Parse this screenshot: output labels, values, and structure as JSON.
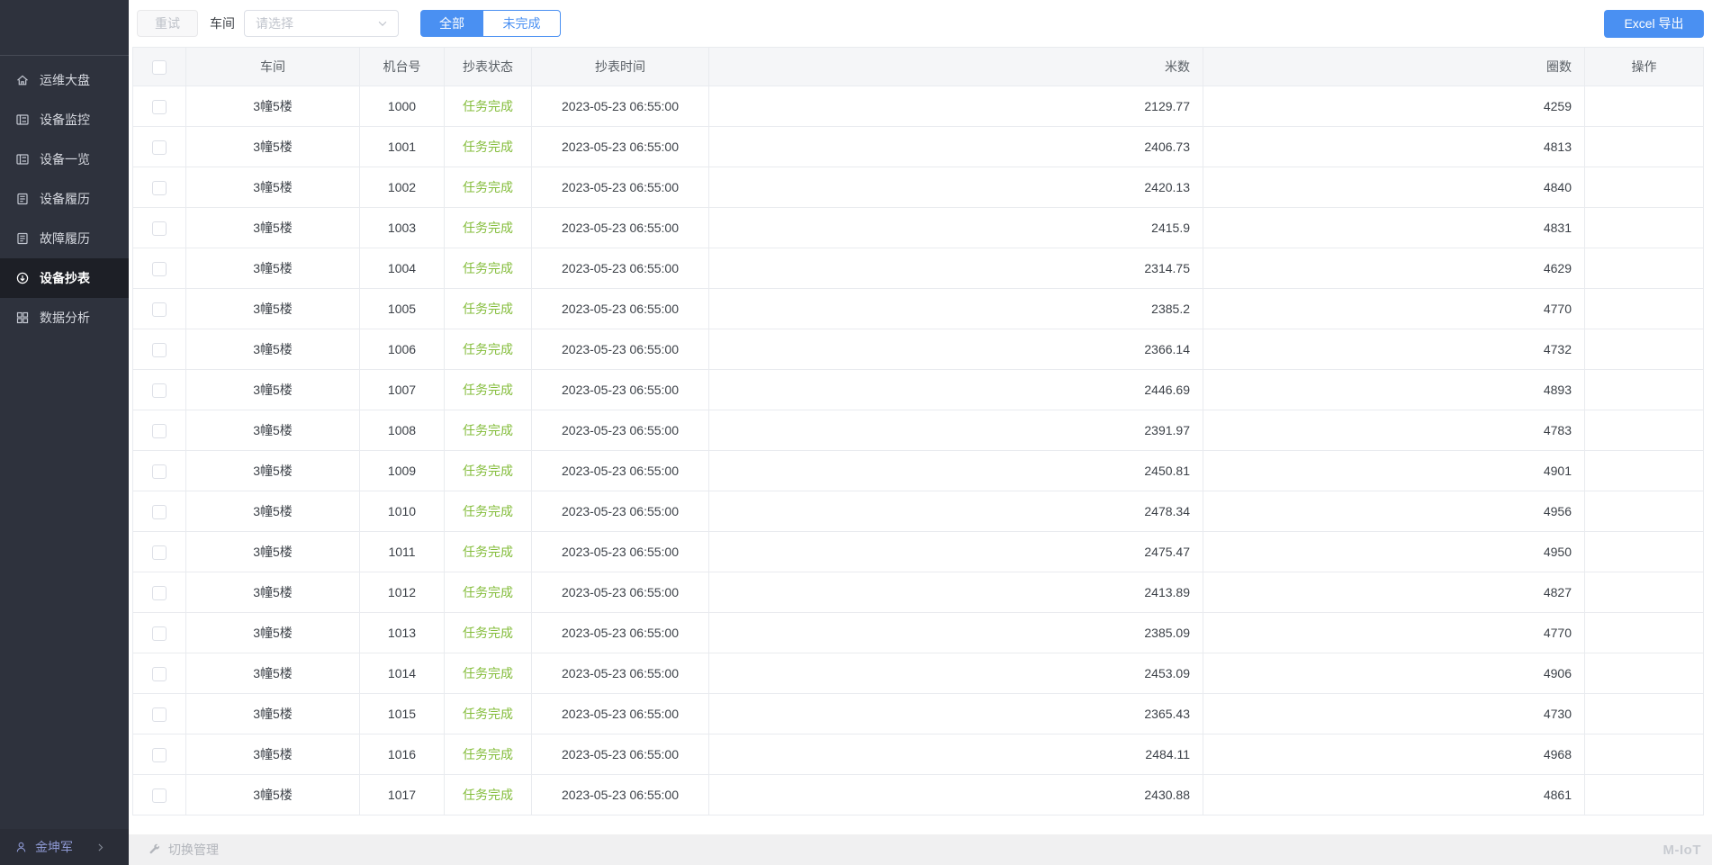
{
  "sidebar": {
    "items": [
      {
        "label": "运维大盘",
        "icon": "home-icon",
        "active": false
      },
      {
        "label": "设备监控",
        "icon": "device-monitor-icon",
        "active": false
      },
      {
        "label": "设备一览",
        "icon": "device-list-icon",
        "active": false
      },
      {
        "label": "设备履历",
        "icon": "device-history-icon",
        "active": false
      },
      {
        "label": "故障履历",
        "icon": "fault-history-icon",
        "active": false
      },
      {
        "label": "设备抄表",
        "icon": "meter-reading-icon",
        "active": true
      },
      {
        "label": "数据分析",
        "icon": "data-analysis-icon",
        "active": false
      }
    ],
    "user": {
      "name": "金坤军"
    }
  },
  "toolbar": {
    "retry_label": "重试",
    "workshop_label": "车间",
    "select_placeholder": "请选择",
    "filter_all": "全部",
    "filter_incomplete": "未完成",
    "export_label": "Excel 导出"
  },
  "table": {
    "columns": [
      "车间",
      "机台号",
      "抄表状态",
      "抄表时间",
      "米数",
      "圈数",
      "操作"
    ],
    "rows": [
      {
        "workshop": "3幢5楼",
        "machine": "1000",
        "status": "任务完成",
        "time": "2023-05-23 06:55:00",
        "meters": "2129.77",
        "loops": "4259"
      },
      {
        "workshop": "3幢5楼",
        "machine": "1001",
        "status": "任务完成",
        "time": "2023-05-23 06:55:00",
        "meters": "2406.73",
        "loops": "4813"
      },
      {
        "workshop": "3幢5楼",
        "machine": "1002",
        "status": "任务完成",
        "time": "2023-05-23 06:55:00",
        "meters": "2420.13",
        "loops": "4840"
      },
      {
        "workshop": "3幢5楼",
        "machine": "1003",
        "status": "任务完成",
        "time": "2023-05-23 06:55:00",
        "meters": "2415.9",
        "loops": "4831"
      },
      {
        "workshop": "3幢5楼",
        "machine": "1004",
        "status": "任务完成",
        "time": "2023-05-23 06:55:00",
        "meters": "2314.75",
        "loops": "4629"
      },
      {
        "workshop": "3幢5楼",
        "machine": "1005",
        "status": "任务完成",
        "time": "2023-05-23 06:55:00",
        "meters": "2385.2",
        "loops": "4770"
      },
      {
        "workshop": "3幢5楼",
        "machine": "1006",
        "status": "任务完成",
        "time": "2023-05-23 06:55:00",
        "meters": "2366.14",
        "loops": "4732"
      },
      {
        "workshop": "3幢5楼",
        "machine": "1007",
        "status": "任务完成",
        "time": "2023-05-23 06:55:00",
        "meters": "2446.69",
        "loops": "4893"
      },
      {
        "workshop": "3幢5楼",
        "machine": "1008",
        "status": "任务完成",
        "time": "2023-05-23 06:55:00",
        "meters": "2391.97",
        "loops": "4783"
      },
      {
        "workshop": "3幢5楼",
        "machine": "1009",
        "status": "任务完成",
        "time": "2023-05-23 06:55:00",
        "meters": "2450.81",
        "loops": "4901"
      },
      {
        "workshop": "3幢5楼",
        "machine": "1010",
        "status": "任务完成",
        "time": "2023-05-23 06:55:00",
        "meters": "2478.34",
        "loops": "4956"
      },
      {
        "workshop": "3幢5楼",
        "machine": "1011",
        "status": "任务完成",
        "time": "2023-05-23 06:55:00",
        "meters": "2475.47",
        "loops": "4950"
      },
      {
        "workshop": "3幢5楼",
        "machine": "1012",
        "status": "任务完成",
        "time": "2023-05-23 06:55:00",
        "meters": "2413.89",
        "loops": "4827"
      },
      {
        "workshop": "3幢5楼",
        "machine": "1013",
        "status": "任务完成",
        "time": "2023-05-23 06:55:00",
        "meters": "2385.09",
        "loops": "4770"
      },
      {
        "workshop": "3幢5楼",
        "machine": "1014",
        "status": "任务完成",
        "time": "2023-05-23 06:55:00",
        "meters": "2453.09",
        "loops": "4906"
      },
      {
        "workshop": "3幢5楼",
        "machine": "1015",
        "status": "任务完成",
        "time": "2023-05-23 06:55:00",
        "meters": "2365.43",
        "loops": "4730"
      },
      {
        "workshop": "3幢5楼",
        "machine": "1016",
        "status": "任务完成",
        "time": "2023-05-23 06:55:00",
        "meters": "2484.11",
        "loops": "4968"
      },
      {
        "workshop": "3幢5楼",
        "machine": "1017",
        "status": "任务完成",
        "time": "2023-05-23 06:55:00",
        "meters": "2430.88",
        "loops": "4861"
      }
    ]
  },
  "footer": {
    "switch_label": "切换管理",
    "brand": "M-IoT"
  },
  "colors": {
    "primary_blue": "#4a90f2",
    "status_green": "#84bd3b",
    "sidebar_bg": "#2e323d",
    "sidebar_active_bg": "#1d1f26",
    "user_name_color": "#8d98d2"
  }
}
